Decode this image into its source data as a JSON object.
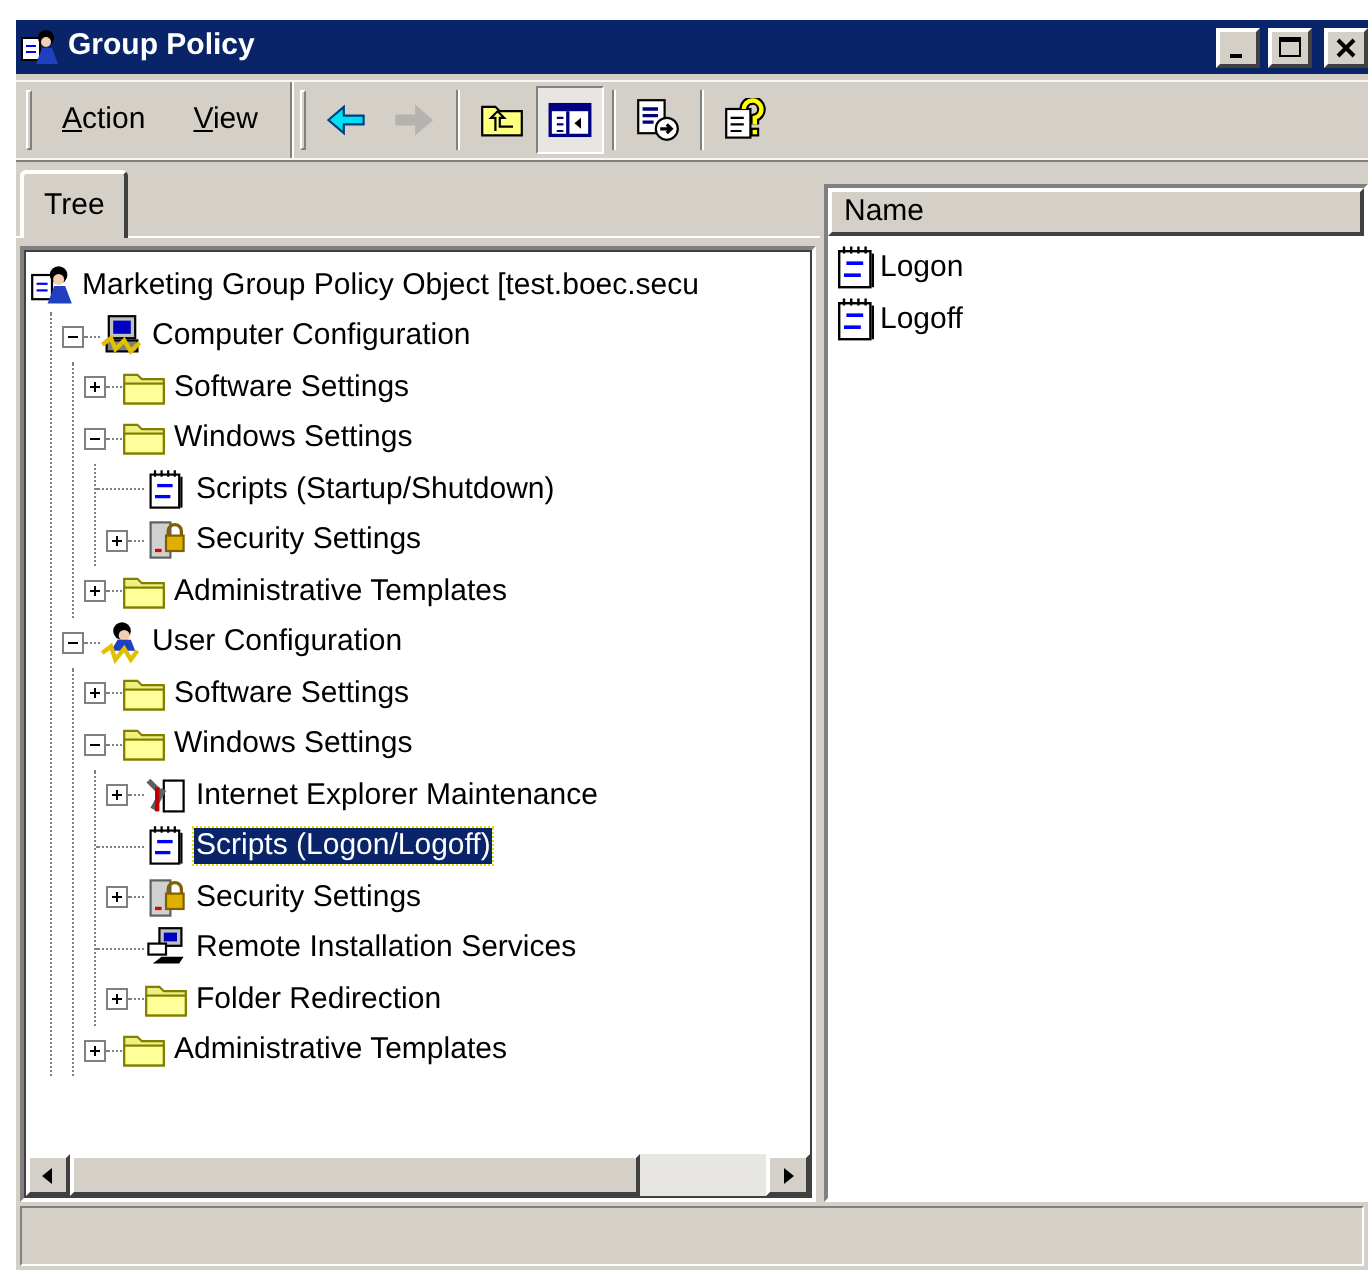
{
  "window": {
    "title": "Group Policy"
  },
  "menus": [
    {
      "label": "Action"
    },
    {
      "label": "View"
    }
  ],
  "toolbar": [
    {
      "kind": "back",
      "disabled": false,
      "pressed": false
    },
    {
      "kind": "forward",
      "disabled": true,
      "pressed": false
    },
    {
      "kind": "sep"
    },
    {
      "kind": "up",
      "disabled": false,
      "pressed": false
    },
    {
      "kind": "tree",
      "disabled": false,
      "pressed": true
    },
    {
      "kind": "sep"
    },
    {
      "kind": "export",
      "disabled": false,
      "pressed": false
    },
    {
      "kind": "sep"
    },
    {
      "kind": "help",
      "disabled": false,
      "pressed": false
    }
  ],
  "tabs": [
    {
      "label": "Tree",
      "selected": true
    }
  ],
  "tree": [
    {
      "label": "Marketing Group Policy Object [test.boec.secu",
      "kind": "gpo",
      "selected": false,
      "children": [
        {
          "label": "Computer Configuration",
          "kind": "computer",
          "expanded": true,
          "selected": false,
          "children": [
            {
              "label": "Software Settings",
              "kind": "folder",
              "expanded": false,
              "selected": false
            },
            {
              "label": "Windows Settings",
              "kind": "folder",
              "expanded": true,
              "selected": false,
              "children": [
                {
                  "label": "Scripts (Startup/Shutdown)",
                  "kind": "script",
                  "selected": false
                },
                {
                  "label": "Security Settings",
                  "kind": "security",
                  "expanded": false,
                  "selected": false
                }
              ]
            },
            {
              "label": "Administrative Templates",
              "kind": "folder",
              "expanded": false,
              "selected": false
            }
          ]
        },
        {
          "label": "User Configuration",
          "kind": "user",
          "expanded": true,
          "selected": false,
          "children": [
            {
              "label": "Software Settings",
              "kind": "folder",
              "expanded": false,
              "selected": false
            },
            {
              "label": "Windows Settings",
              "kind": "folder",
              "expanded": true,
              "selected": false,
              "children": [
                {
                  "label": "Internet Explorer Maintenance",
                  "kind": "ie",
                  "expanded": false,
                  "selected": false
                },
                {
                  "label": "Scripts (Logon/Logoff)",
                  "kind": "script",
                  "selected": true
                },
                {
                  "label": "Security Settings",
                  "kind": "security",
                  "expanded": false,
                  "selected": false
                },
                {
                  "label": "Remote Installation Services",
                  "kind": "remote",
                  "selected": false
                },
                {
                  "label": "Folder Redirection",
                  "kind": "folder",
                  "expanded": false,
                  "selected": false
                }
              ]
            },
            {
              "label": "Administrative Templates",
              "kind": "folder",
              "expanded": false,
              "selected": false
            }
          ]
        }
      ]
    }
  ],
  "list": {
    "columns": [
      "Name"
    ],
    "items": [
      {
        "label": "Logon",
        "kind": "script"
      },
      {
        "label": "Logoff",
        "kind": "script"
      }
    ]
  }
}
